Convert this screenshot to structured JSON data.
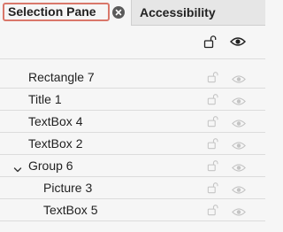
{
  "tabs": [
    {
      "label": "Selection Pane"
    },
    {
      "label": "Accessibility"
    }
  ],
  "icons": {
    "header_lock": "unlock-icon",
    "header_eye": "eye-icon",
    "tab_close": "close-icon",
    "group_toggle": "chevron-down-icon"
  },
  "items": [
    {
      "name": "Rectangle 7",
      "indent": 0
    },
    {
      "name": "Title 1",
      "indent": 0
    },
    {
      "name": "TextBox 4",
      "indent": 0
    },
    {
      "name": "TextBox 2",
      "indent": 0
    },
    {
      "name": "Group 6",
      "indent": 0,
      "group": true,
      "expanded": true
    },
    {
      "name": "Picture 3",
      "indent": 1
    },
    {
      "name": "TextBox 5",
      "indent": 1
    }
  ],
  "colors": {
    "tab_highlight": "#d9776a",
    "row_icon": "#c4c4c4",
    "header_icon": "#222222"
  }
}
